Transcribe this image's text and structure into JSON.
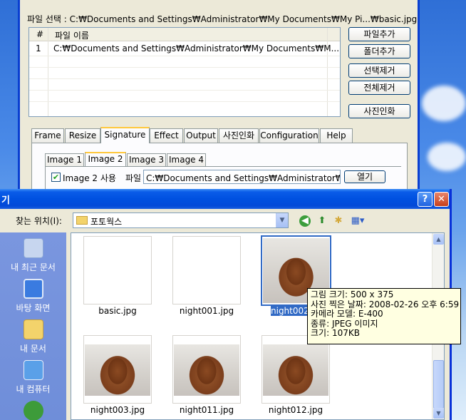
{
  "app": {
    "file_select": "파일 선택 : C:₩Documents and Settings₩Administrator₩My Documents₩My Pi...₩basic.jpg",
    "list": {
      "col_num": "#",
      "col_name": "파일 이름",
      "rows": [
        {
          "num": "1",
          "name": "C:₩Documents and Settings₩Administrator₩My Documents₩M..."
        }
      ]
    },
    "buttons": {
      "add_file": "파일추가",
      "add_folder": "폴더추가",
      "remove_selected": "선택제거",
      "remove_all": "전체제거",
      "print_photo": "사진인화"
    },
    "tabs": [
      "Frame",
      "Resize",
      "Signature",
      "Effect",
      "Output",
      "사진인화",
      "Configuration",
      "Help"
    ],
    "active_tab": "Signature",
    "subtabs": [
      "Image 1",
      "Image 2",
      "Image 3",
      "Image 4"
    ],
    "active_subtab": "Image 2",
    "use_image_label": "Image 2 사용",
    "use_image_checked": "✔",
    "file_label": "파일",
    "file_path": "C:₩Documents and Settings₩Administrator₩바",
    "open_button": "열기"
  },
  "dialog": {
    "title": "기",
    "help_btn": "?",
    "close_btn": "✕",
    "look_in_label": "찾는 위치(I):",
    "look_in_value": "포토웍스",
    "places": [
      {
        "label": "내 최근 문서",
        "icon": "recent-documents-icon",
        "color": "#c7d6ef"
      },
      {
        "label": "바탕 화면",
        "icon": "desktop-icon",
        "color": "#3a7be0"
      },
      {
        "label": "내 문서",
        "icon": "my-documents-icon",
        "color": "#f3d36b"
      },
      {
        "label": "내 컴퓨터",
        "icon": "my-computer-icon",
        "color": "#5aa0e8"
      },
      {
        "label": "",
        "icon": "network-icon",
        "color": "#3d9b3a"
      }
    ],
    "files": [
      "basic.jpg",
      "night001.jpg",
      "night002.jpg",
      "night003.jpg",
      "night011.jpg",
      "night012.jpg"
    ],
    "selected_file": "night002.jpg",
    "tooltip": {
      "line1": "그림 크기: 500 x 375",
      "line2": "사진 찍은 날짜: 2008-02-26 오후 6:59",
      "line3": "카메라 모델: E-400",
      "line4": "종류: JPEG 이미지",
      "line5": "크기: 107KB"
    }
  }
}
